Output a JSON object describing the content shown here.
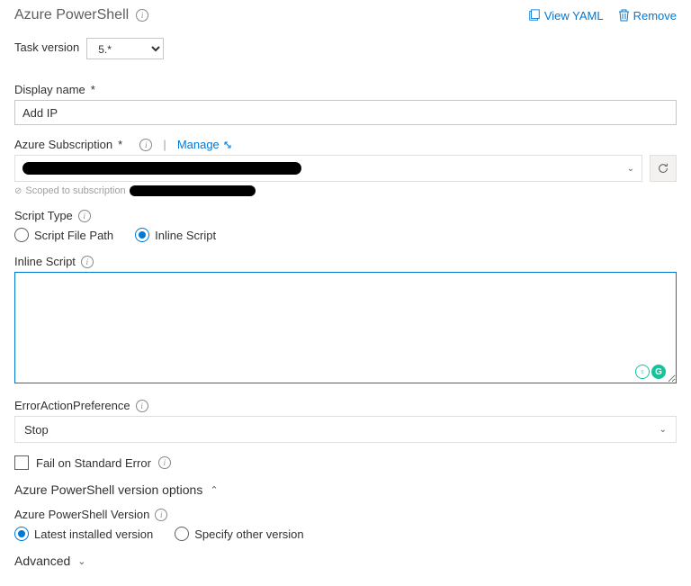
{
  "header": {
    "title": "Azure PowerShell",
    "view_yaml": "View YAML",
    "remove": "Remove"
  },
  "task_version": {
    "label": "Task version",
    "value": "5.*"
  },
  "display_name": {
    "label": "Display name",
    "required": "*",
    "value": "Add IP"
  },
  "azure_subscription": {
    "label": "Azure Subscription",
    "required": "*",
    "manage": "Manage",
    "scoped_prefix": "Scoped to subscription"
  },
  "script_type": {
    "label": "Script Type",
    "file_path": "Script File Path",
    "inline": "Inline Script",
    "selected": "inline"
  },
  "inline_script": {
    "label": "Inline Script",
    "value": ""
  },
  "error_action": {
    "label": "ErrorActionPreference",
    "value": "Stop"
  },
  "fail_on_stderr": {
    "label": "Fail on Standard Error",
    "checked": false
  },
  "ps_version_section": {
    "title": "Azure PowerShell version options",
    "label": "Azure PowerShell Version",
    "latest": "Latest installed version",
    "specify": "Specify other version",
    "selected": "latest"
  },
  "advanced": {
    "title": "Advanced"
  }
}
